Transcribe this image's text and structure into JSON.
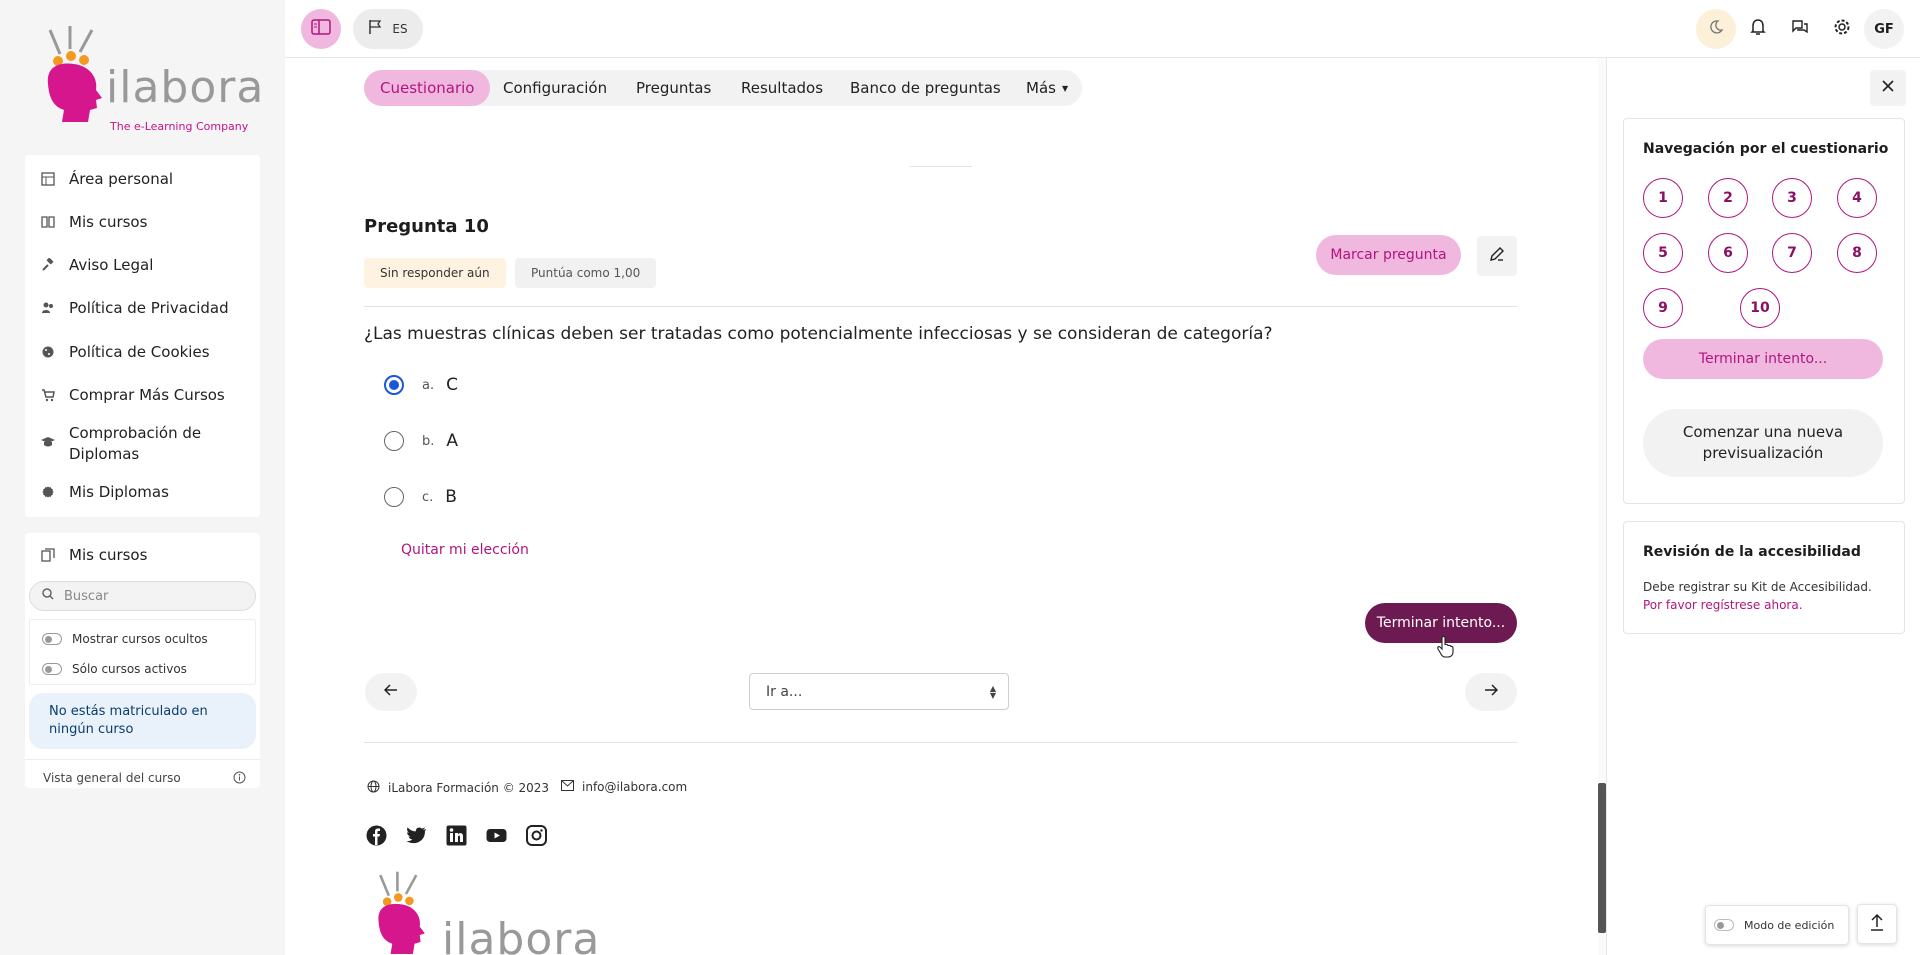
{
  "brand": {
    "logo_text": "ilabora",
    "tagline": "The e-Learning Company"
  },
  "topbar": {
    "language": "ES",
    "avatar_initials": "GF"
  },
  "sidebar": {
    "items": [
      {
        "label": "Área personal",
        "icon": "dashboard-icon"
      },
      {
        "label": "Mis cursos",
        "icon": "book-icon"
      },
      {
        "label": "Aviso Legal",
        "icon": "gavel-icon"
      },
      {
        "label": "Política de Privacidad",
        "icon": "users-icon"
      },
      {
        "label": "Política de Cookies",
        "icon": "cookie-icon"
      },
      {
        "label": "Comprar Más Cursos",
        "icon": "cart-icon"
      },
      {
        "label": "Comprobación de Diplomas",
        "icon": "graduation-cap-icon"
      },
      {
        "label": "Mis Diplomas",
        "icon": "certificate-icon"
      }
    ],
    "courses_block": {
      "title": "Mis cursos",
      "search_placeholder": "Buscar",
      "filter_hidden": "Mostrar cursos ocultos",
      "filter_active": "Sólo cursos activos",
      "empty_message": "No estás matriculado en ningún curso",
      "overview_label": "Vista general del curso"
    }
  },
  "tabs": [
    {
      "label": "Cuestionario",
      "active": true
    },
    {
      "label": "Configuración",
      "active": false
    },
    {
      "label": "Preguntas",
      "active": false
    },
    {
      "label": "Resultados",
      "active": false
    },
    {
      "label": "Banco de preguntas",
      "active": false
    },
    {
      "label": "Más",
      "active": false
    }
  ],
  "question": {
    "title": "Pregunta 10",
    "status": "Sin responder aún",
    "grade": "Puntúa como 1,00",
    "flag_label": "Marcar pregunta",
    "text": "¿Las muestras clínicas deben ser tratadas como potencialmente infecciosas y se consideran de categoría?",
    "options": [
      {
        "letter": "a.",
        "text": "C",
        "selected": true
      },
      {
        "letter": "b.",
        "text": "A",
        "selected": false
      },
      {
        "letter": "c.",
        "text": "B",
        "selected": false
      }
    ],
    "clear_choice": "Quitar mi elección",
    "finish_label": "Terminar intento...",
    "jump_placeholder": "Ir a..."
  },
  "footer": {
    "copyright": "iLabora Formación © 2023",
    "email": "info@ilabora.com"
  },
  "drawer": {
    "nav_title": "Navegación por el cuestionario",
    "question_numbers": [
      "1",
      "2",
      "3",
      "4",
      "5",
      "6",
      "7",
      "8",
      "9",
      "10"
    ],
    "finish_label": "Terminar intento...",
    "new_preview_label": "Comenzar una nueva previsualización",
    "accessibility_title": "Revisión de la accesibilidad",
    "accessibility_text": "Debe registrar su Kit de Accesibilidad.",
    "accessibility_link": "Por favor regístrese ahora."
  },
  "edit_mode_label": "Modo de edición",
  "colors": {
    "accent": "#b0167e",
    "accent_light": "#f0b8de",
    "dark_button": "#6d1a52"
  }
}
